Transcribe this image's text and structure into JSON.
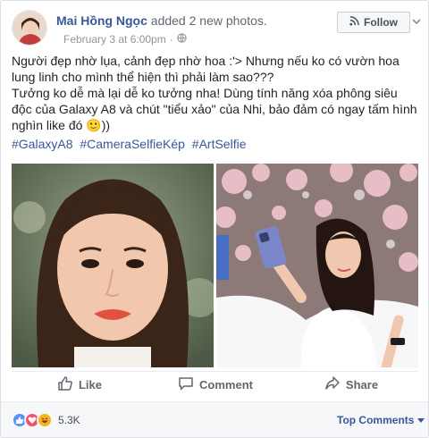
{
  "post": {
    "author": "Mai Hồng Ngọc",
    "action": "added 2 new photos.",
    "date": "February 3 at 6:00pm",
    "separator": "·",
    "follow_label": "Follow",
    "text_lines": [
      "Người đẹp nhờ lụa, cảnh đẹp nhờ hoa :'> Nhưng nếu ko có vườn hoa lung linh cho mình thể hiện thì phải làm sao???",
      "Tưởng ko dễ mà lại dễ ko tưởng nha! Dùng tính năng xóa phông siêu độc của Galaxy A8 và chút \"tiểu xảo\" của Nhi, bảo đảm có ngay tấm hình nghìn like đó 🙂))"
    ],
    "hashtags": [
      "#GalaxyA8",
      "#CameraSelfieKép",
      "#ArtSelfie"
    ]
  },
  "actions": {
    "like": "Like",
    "comment": "Comment",
    "share": "Share"
  },
  "footer": {
    "reaction_count": "5.3K",
    "top_comments": "Top Comments"
  },
  "colors": {
    "link": "#365899",
    "like_blue": "#5890ff",
    "love_red": "#f25268",
    "haha_yellow": "#f7b125"
  }
}
